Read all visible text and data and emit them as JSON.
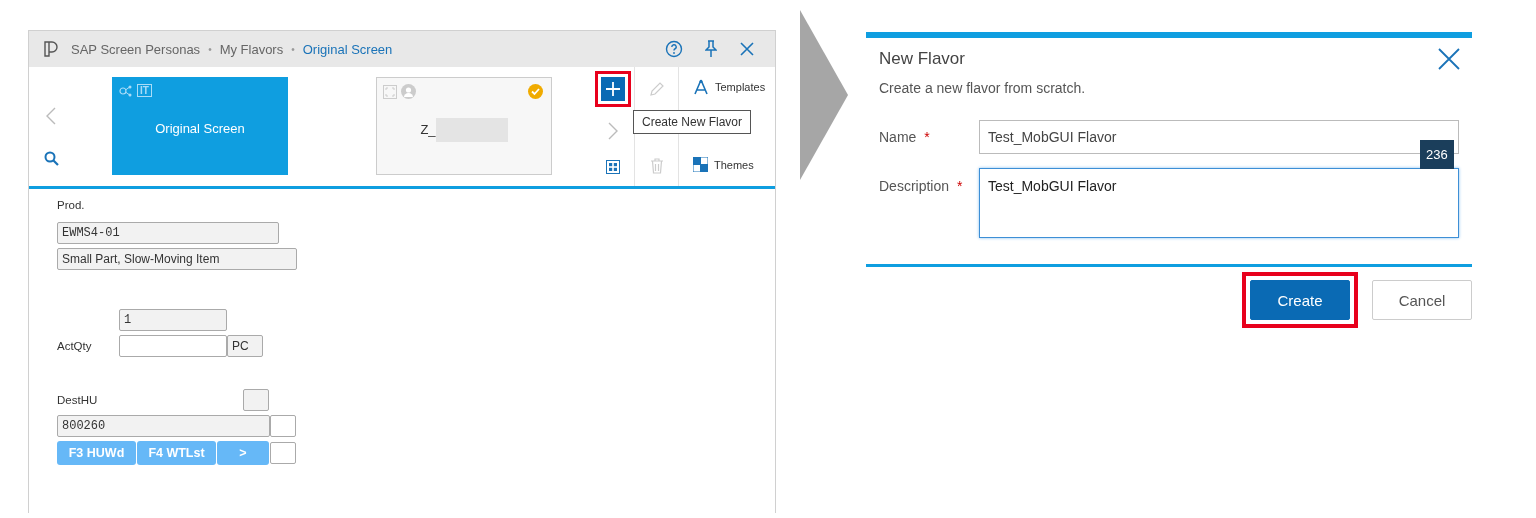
{
  "left_window": {
    "breadcrumb": [
      {
        "label": "SAP Screen Personas",
        "current": false
      },
      {
        "separator": "•",
        "label": "My Flavors",
        "current": false
      },
      {
        "separator": "•",
        "label": "Original Screen",
        "current": true
      }
    ],
    "flavors": [
      {
        "title": "Original Screen",
        "selected": true,
        "badge": "IT",
        "checked": false
      },
      {
        "title": "Z_",
        "selected": false,
        "checked": true
      }
    ],
    "new_button": {
      "highlighted": true
    },
    "tooltip": "Create New Flavor",
    "side_buttons": [
      {
        "label": "Templates",
        "kind": "templates"
      },
      {
        "label": "Themes",
        "kind": "themes"
      }
    ],
    "form": {
      "prod_label": "Prod.",
      "product": "EWMS4-01",
      "description": "Small Part, Slow-Moving Item",
      "qty": "1",
      "actqty_label": "ActQty",
      "unit": "PC",
      "desthu_label": "DestHU",
      "desthu_checked": false,
      "desthu": "800260",
      "buttons": [
        "F3 HUWd",
        "F4 WTLst",
        ">"
      ]
    }
  },
  "dialog": {
    "title": "New Flavor",
    "subtitle": "Create a new flavor from scratch.",
    "fields": [
      {
        "label": "Name",
        "required_mark": "*",
        "value": "Test_MobGUI Flavor",
        "kind": "input",
        "focused": false
      },
      {
        "label": "Description",
        "required_mark": "*",
        "value": "Test_MobGUI Flavor",
        "kind": "textarea",
        "focused": true
      }
    ],
    "counter": "236",
    "buttons": [
      {
        "label": "Create",
        "primary": true,
        "highlighted": true
      },
      {
        "label": "Cancel",
        "primary": false,
        "highlighted": false
      }
    ]
  }
}
